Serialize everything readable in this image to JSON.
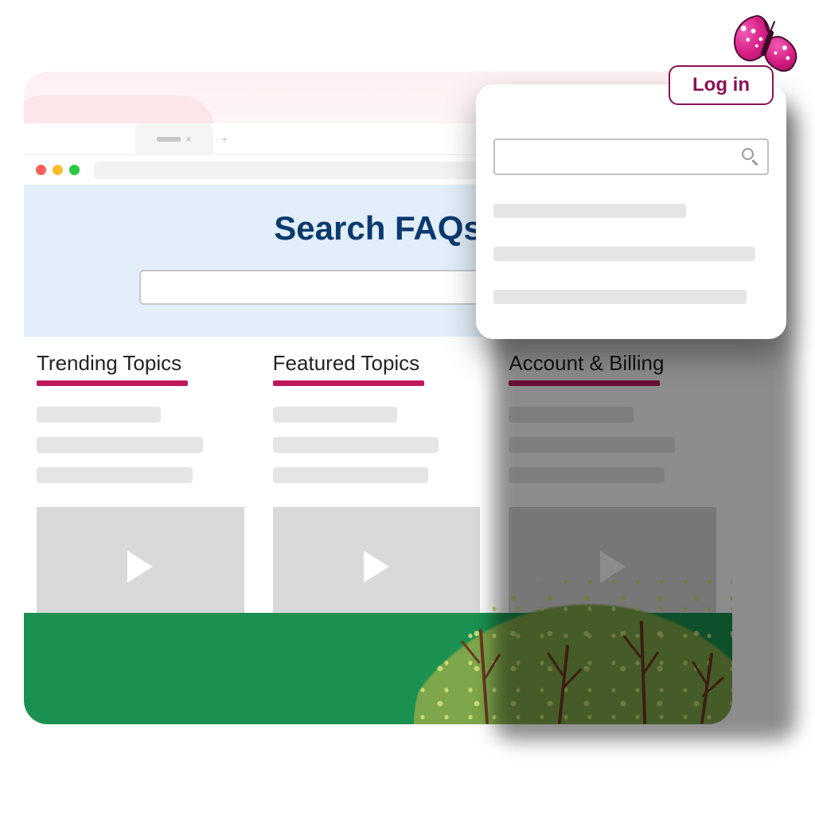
{
  "login_label": "Log in",
  "hero": {
    "title": "Search FAQs"
  },
  "columns": [
    {
      "title": "Trending Topics"
    },
    {
      "title": "Featured Topics"
    },
    {
      "title": "Account & Billing"
    }
  ],
  "colors": {
    "accent": "#be185d",
    "hero_title": "#0b3a6f"
  }
}
